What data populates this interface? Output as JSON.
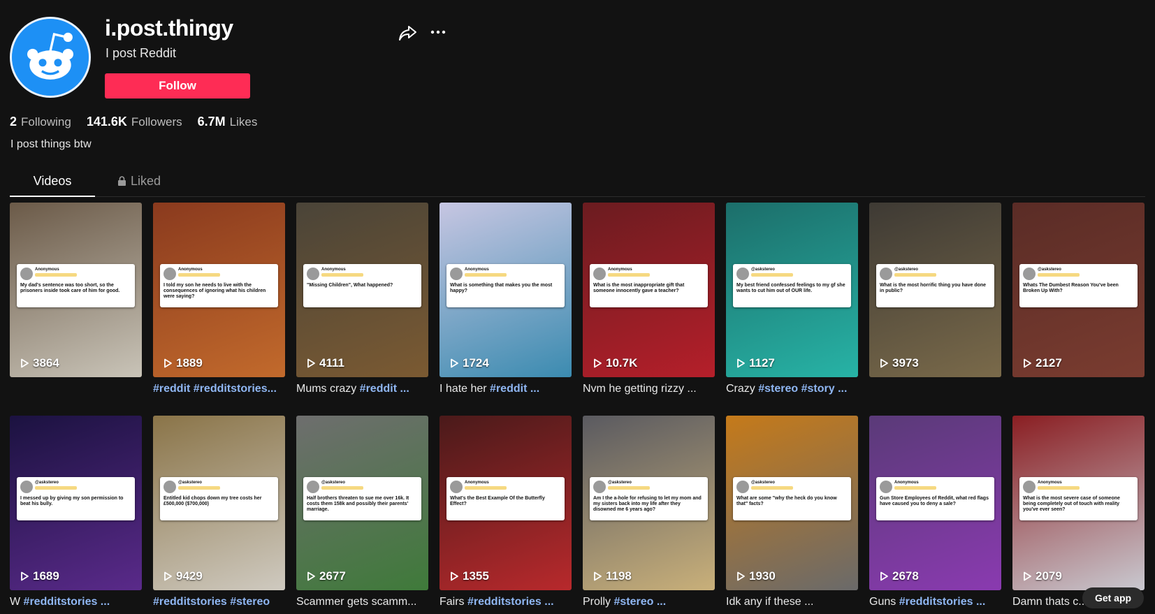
{
  "profile": {
    "username": "i.post.thingy",
    "nickname": "I post Reddit",
    "follow_label": "Follow",
    "bio": "I post things btw",
    "stats": [
      {
        "value": "2",
        "label": "Following"
      },
      {
        "value": "141.6K",
        "label": "Followers"
      },
      {
        "value": "6.7M",
        "label": "Likes"
      }
    ]
  },
  "icons": {
    "share": "share-arrow-icon",
    "more": "more-dots-icon",
    "lock": "lock-icon",
    "play": "play-icon",
    "avatar": "reddit-snoo-icon"
  },
  "tabs": [
    {
      "label": "Videos",
      "active": true
    },
    {
      "label": "Liked",
      "active": false
    }
  ],
  "videos": [
    {
      "views": "3864",
      "caption_text": "",
      "caption_tags": "",
      "post_author": "Anonymous",
      "post_text": "My dad's sentence was too short, so the prisoners inside took care of him for good.",
      "colors": [
        "#6b5a48",
        "#c9c4b8"
      ]
    },
    {
      "views": "1889",
      "caption_text": "",
      "caption_tags": "#reddit #redditstories...",
      "post_author": "Anonymous",
      "post_text": "I told my son he needs to live with the consequences of ignoring what his children were saying?",
      "colors": [
        "#8a3a1e",
        "#c26a2c"
      ]
    },
    {
      "views": "4111",
      "caption_text": "Mums crazy ",
      "caption_tags": "#reddit ...",
      "post_author": "Anonymous",
      "post_text": "\"Missing Children\", What happened?",
      "colors": [
        "#4a4438",
        "#7b5a32"
      ]
    },
    {
      "views": "1724",
      "caption_text": "I hate her ",
      "caption_tags": "#reddit ...",
      "post_author": "Anonymous",
      "post_text": "What is something that makes you the most happy?",
      "colors": [
        "#c7c6e2",
        "#3b8bb0"
      ]
    },
    {
      "views": "10.7K",
      "caption_text": "Nvm he getting rizzy ...",
      "caption_tags": "",
      "post_author": "Anonymous",
      "post_text": "What is the most inappropriate gift that someone innocently gave a teacher?",
      "colors": [
        "#6b1c20",
        "#b51f2a"
      ]
    },
    {
      "views": "1127",
      "caption_text": "Crazy ",
      "caption_tags": "#stereo #story ...",
      "post_author": "@askstereo",
      "post_text": "My best friend confessed feelings to my gf she wants to cut him out of OUR life.",
      "colors": [
        "#1c6e6a",
        "#27b3a6"
      ]
    },
    {
      "views": "3973",
      "caption_text": "",
      "caption_tags": "",
      "post_author": "@askstereo",
      "post_text": "What is the most horrific thing you have done in public?",
      "colors": [
        "#3e3a34",
        "#7a6a4a"
      ]
    },
    {
      "views": "2127",
      "caption_text": "",
      "caption_tags": "",
      "post_author": "@askstereo",
      "post_text": "Whats The Dumbest Reason You've been Broken Up With?",
      "colors": [
        "#5a2c26",
        "#7a3c30"
      ]
    },
    {
      "views": "1689",
      "caption_text": "W ",
      "caption_tags": "#redditstories ...",
      "post_author": "@askstereo",
      "post_text": "I messed up by giving my son permission to beat his bully.",
      "colors": [
        "#1b1240",
        "#5a2a8a"
      ]
    },
    {
      "views": "9429",
      "caption_text": "",
      "caption_tags": "#redditstories #stereo",
      "post_author": "@askstereo",
      "post_text": "Entitled kid chops down my tree costs her £500,000 ($700,000)",
      "colors": [
        "#8a7448",
        "#cfcac0"
      ]
    },
    {
      "views": "2677",
      "caption_text": "Scammer gets scamm...",
      "caption_tags": "",
      "post_author": "@askstereo",
      "post_text": "Half brothers threaten to sue me over 16k. It costs them 158k and possibly their parents' marriage.",
      "colors": [
        "#6e6e6e",
        "#3f7a3a"
      ]
    },
    {
      "views": "1355",
      "caption_text": "Fairs ",
      "caption_tags": "#redditstories ...",
      "post_author": "Anonymous",
      "post_text": "What's the Best Example Of the Butterfly Effect?",
      "colors": [
        "#4a1a1a",
        "#b8292c"
      ]
    },
    {
      "views": "1198",
      "caption_text": "Prolly ",
      "caption_tags": "#stereo ...",
      "post_author": "@askstereo",
      "post_text": "Am I the a-hole for refusing to let my mom and my sisters back into my life after they disowned me 6 years ago?",
      "colors": [
        "#5a5a60",
        "#c9b07a"
      ]
    },
    {
      "views": "1930",
      "caption_text": "Idk any if these ...",
      "caption_tags": "",
      "post_author": "@askstereo",
      "post_text": "What are some \"why the heck do you know that\" facts?",
      "colors": [
        "#c57a1a",
        "#6a6a6a"
      ]
    },
    {
      "views": "2678",
      "caption_text": "Guns ",
      "caption_tags": "#redditstories ...",
      "post_author": "Anonymous",
      "post_text": "Gun Store Employees of Reddit, what red flags have caused you to deny a sale?",
      "colors": [
        "#5a3a78",
        "#8a3ab0"
      ]
    },
    {
      "views": "2079",
      "caption_text": "Damn thats c...",
      "caption_tags": "",
      "post_author": "Anonymous",
      "post_text": "What is the most severe case of someone being completely out of touch with reality you've ever seen?",
      "colors": [
        "#8a1e22",
        "#c9c9d0"
      ]
    }
  ],
  "get_app_label": "Get app"
}
